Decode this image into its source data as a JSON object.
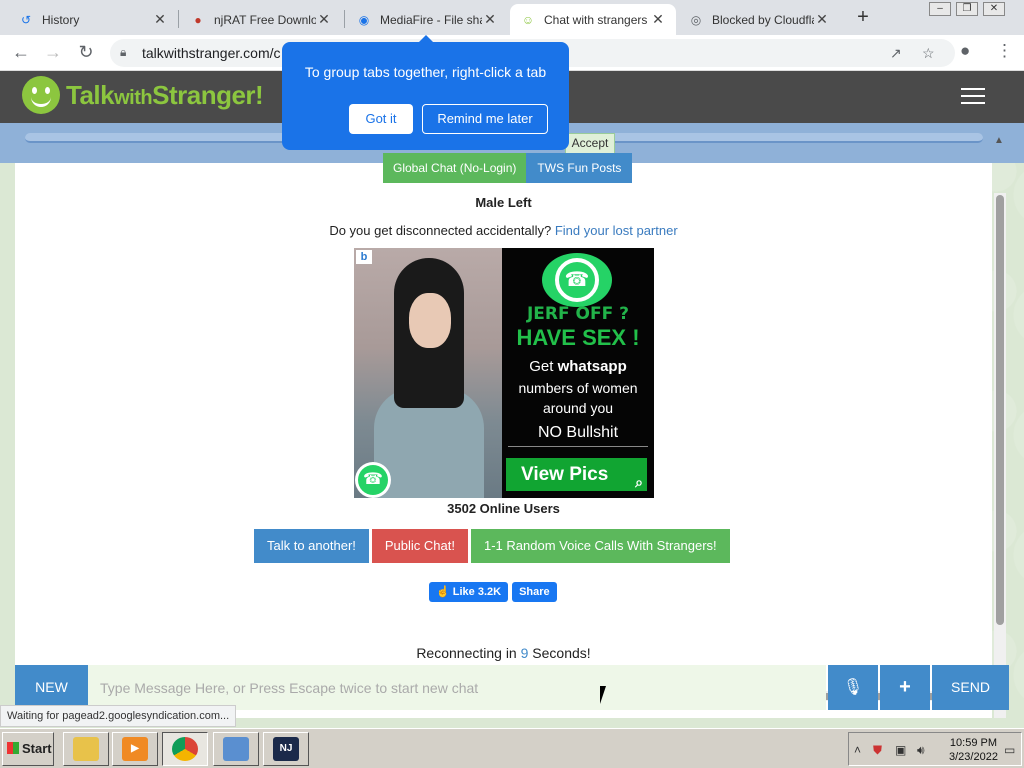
{
  "browser": {
    "tabs": [
      {
        "title": "History",
        "icon": "history-icon"
      },
      {
        "title": "njRAT Free Download",
        "icon": "location-pin-icon"
      },
      {
        "title": "MediaFire - File sharing",
        "icon": "mediafire-icon"
      },
      {
        "title": "Chat with strangers",
        "icon": "smiley-icon",
        "active": true
      },
      {
        "title": "Blocked by Cloudflare",
        "icon": "globe-icon"
      }
    ],
    "url": "talkwithstranger.com/c",
    "tab_group_popup": {
      "message": "To group tabs together, right-click a tab",
      "got_it": "Got it",
      "remind_later": "Remind me later"
    }
  },
  "site": {
    "logo": {
      "part1": "Talk",
      "part2": "with",
      "part3": "Stranger!"
    },
    "accept_label": "Accept",
    "top_buttons": [
      "Global Chat (No-Login)",
      "TWS Fun Posts"
    ],
    "status_title": "Male Left",
    "disconnect_text": "Do you get disconnected accidentally?",
    "disconnect_link": "Find your lost partner",
    "ad": {
      "badge": "b",
      "line1": "JERF OFF ?",
      "line2": "HAVE SEX !",
      "line3_prefix": "Get ",
      "line3_bold": "whatsapp",
      "line4": "numbers of women around you",
      "line5": "NO Bullshit",
      "cta": "View Pics"
    },
    "online_users": "3502 Online Users",
    "actions": [
      "Talk to another!",
      "Public Chat!",
      "1-1 Random Voice Calls With Strangers!"
    ],
    "fb_like": "Like 3.2K",
    "fb_share": "Share",
    "reconnect_prefix": "Reconnecting in ",
    "reconnect_seconds": "9",
    "reconnect_suffix": " Seconds!",
    "chat": {
      "new_label": "NEW",
      "placeholder": "Type Message Here, or Press Escape twice to start new chat",
      "send_label": "SEND"
    },
    "status_bar": "Waiting for pagead2.googlesyndication.com..."
  },
  "taskbar": {
    "start_label": "Start",
    "time": "10:59 PM",
    "date": "3/23/2022"
  }
}
